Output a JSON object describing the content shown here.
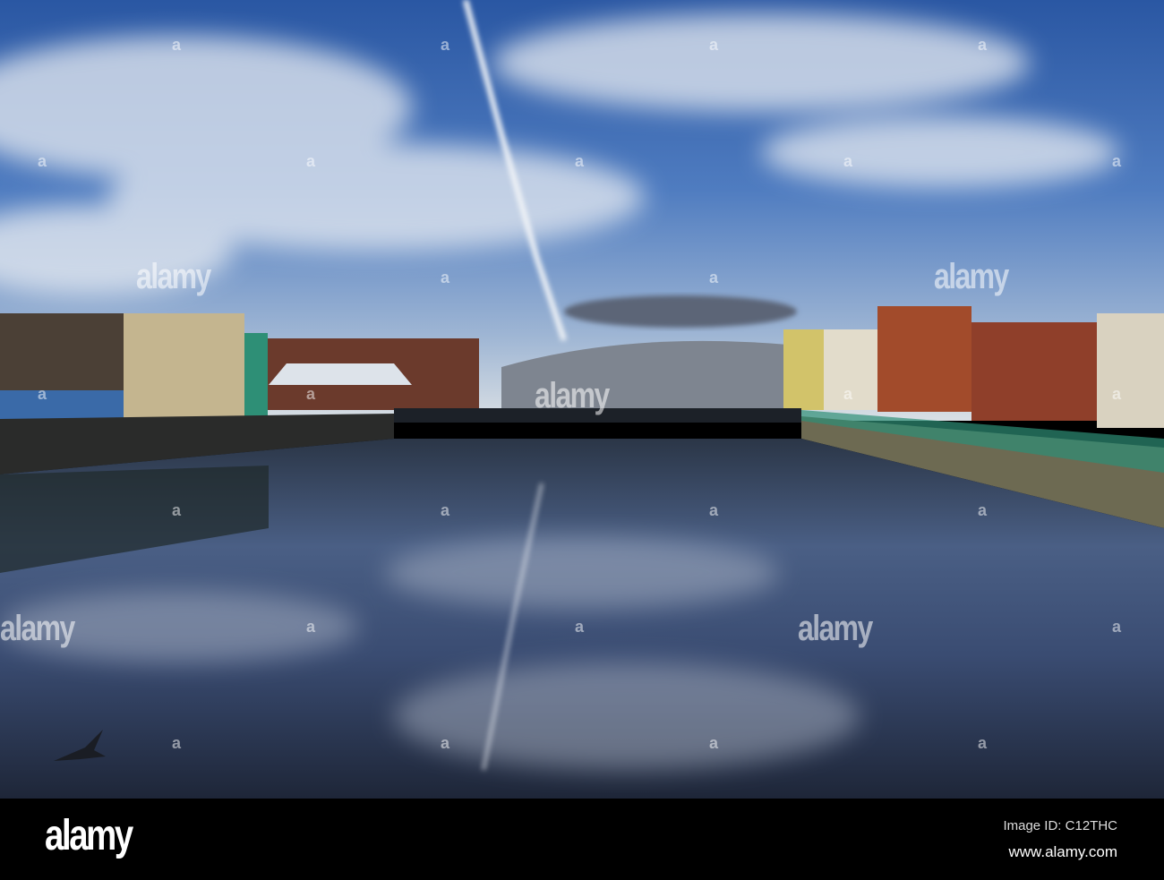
{
  "watermark": {
    "brand": "alamy",
    "mark": "a"
  },
  "footer": {
    "logo": "alamy",
    "image_id": "Image ID: C12THC",
    "url": "www.alamy.com"
  }
}
